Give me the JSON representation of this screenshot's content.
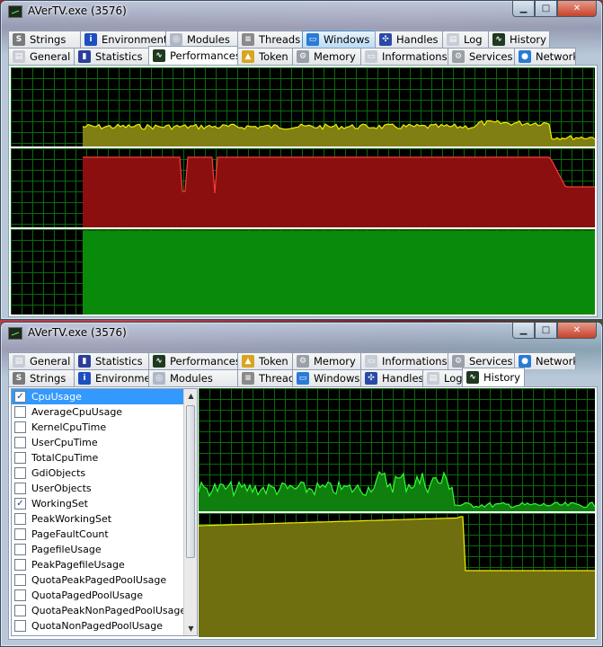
{
  "window_top": {
    "title": "AVerTV.exe (3576)",
    "tabs_row1": [
      {
        "label": "Strings",
        "icon": "strings-icon"
      },
      {
        "label": "Environment",
        "icon": "info-icon"
      },
      {
        "label": "Modules",
        "icon": "modules-icon"
      },
      {
        "label": "Threads",
        "icon": "threads-icon"
      },
      {
        "label": "Windows",
        "icon": "windows-icon"
      },
      {
        "label": "Handles",
        "icon": "handles-icon"
      },
      {
        "label": "Log",
        "icon": "log-icon"
      },
      {
        "label": "History",
        "icon": "history-icon"
      }
    ],
    "tabs_row2": [
      {
        "label": "General",
        "icon": "general-icon"
      },
      {
        "label": "Statistics",
        "icon": "statistics-icon"
      },
      {
        "label": "Performances",
        "icon": "performances-icon"
      },
      {
        "label": "Token",
        "icon": "token-icon"
      },
      {
        "label": "Memory",
        "icon": "memory-icon"
      },
      {
        "label": "Informations",
        "icon": "informations-icon"
      },
      {
        "label": "Services",
        "icon": "services-icon"
      },
      {
        "label": "Network",
        "icon": "network-icon"
      }
    ],
    "selected_tab": "Performances",
    "hot_tab": "Windows"
  },
  "window_bottom": {
    "title": "AVerTV.exe (3576)",
    "tabs_row1": [
      {
        "label": "General",
        "icon": "general-icon"
      },
      {
        "label": "Statistics",
        "icon": "statistics-icon"
      },
      {
        "label": "Performances",
        "icon": "performances-icon"
      },
      {
        "label": "Token",
        "icon": "token-icon"
      },
      {
        "label": "Memory",
        "icon": "memory-icon"
      },
      {
        "label": "Informations",
        "icon": "informations-icon"
      },
      {
        "label": "Services",
        "icon": "services-icon"
      },
      {
        "label": "Network",
        "icon": "network-icon"
      }
    ],
    "tabs_row2": [
      {
        "label": "Strings",
        "icon": "strings-icon"
      },
      {
        "label": "Environment",
        "icon": "info-icon"
      },
      {
        "label": "Modules",
        "icon": "modules-icon"
      },
      {
        "label": "Threads",
        "icon": "threads-icon"
      },
      {
        "label": "Windows",
        "icon": "windows-icon"
      },
      {
        "label": "Handles",
        "icon": "handles-icon"
      },
      {
        "label": "Log",
        "icon": "log-icon"
      },
      {
        "label": "History",
        "icon": "history-icon"
      }
    ],
    "selected_tab": "History",
    "history_items": [
      {
        "label": "CpuUsage",
        "checked": true,
        "selected": true
      },
      {
        "label": "AverageCpuUsage",
        "checked": false
      },
      {
        "label": "KernelCpuTime",
        "checked": false
      },
      {
        "label": "UserCpuTime",
        "checked": false
      },
      {
        "label": "TotalCpuTime",
        "checked": false
      },
      {
        "label": "GdiObjects",
        "checked": false
      },
      {
        "label": "UserObjects",
        "checked": false
      },
      {
        "label": "WorkingSet",
        "checked": true
      },
      {
        "label": "PeakWorkingSet",
        "checked": false
      },
      {
        "label": "PageFaultCount",
        "checked": false
      },
      {
        "label": "PagefileUsage",
        "checked": false
      },
      {
        "label": "PeakPagefileUsage",
        "checked": false
      },
      {
        "label": "QuotaPeakPagedPoolUsage",
        "checked": false
      },
      {
        "label": "QuotaPagedPoolUsage",
        "checked": false
      },
      {
        "label": "QuotaPeakNonPagedPoolUsage",
        "checked": false
      },
      {
        "label": "QuotaNonPagedPoolUsage",
        "checked": false
      }
    ]
  },
  "colors": {
    "graph_bg": "#000000",
    "grid": "#0a6a0a",
    "cpu_fill": "#7f7f14",
    "cpu_line": "#f0f000",
    "memory_fill": "#8b0f0f",
    "memory_line": "#ff3a3a",
    "io_fill": "#0a8a0a",
    "history_cpu_fill": "#0f7f0f",
    "history_cpu_line": "#30ff30",
    "history_ws_fill": "#6f6f10",
    "history_ws_line": "#f0f000",
    "selection": "#3399ff"
  }
}
